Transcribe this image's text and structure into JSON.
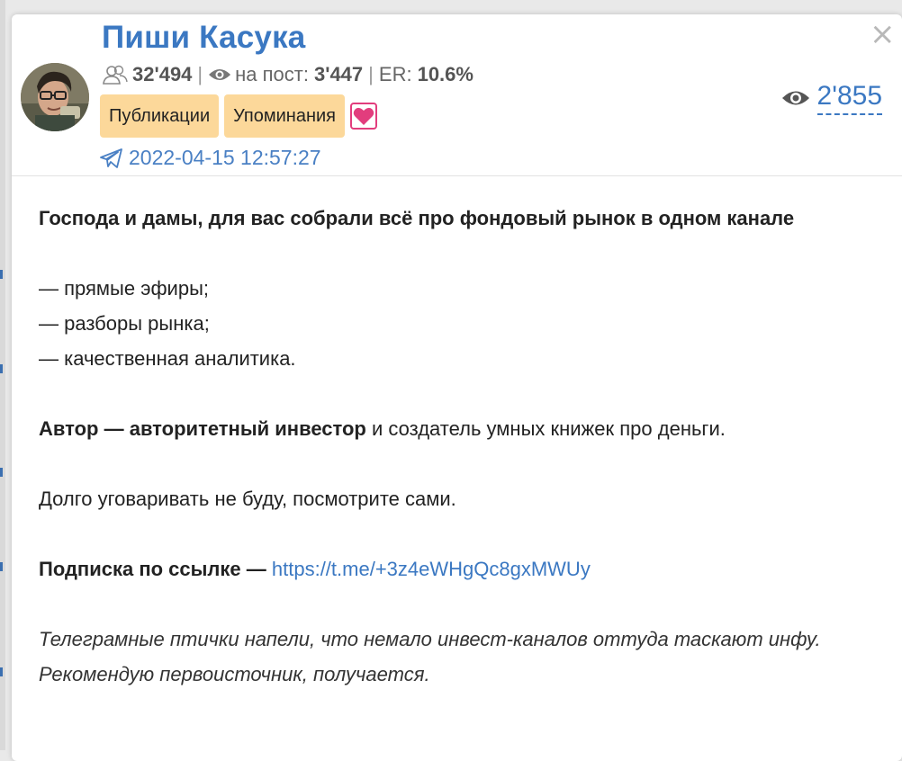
{
  "channel": {
    "title": "Пиши Касука",
    "subscribers": "32'494",
    "reach_label": "на пост:",
    "reach": "3'447",
    "er_label": "ER:",
    "er": "10.6%",
    "date": "2022-04-15 12:57:27",
    "views": "2'855"
  },
  "buttons": {
    "publications": "Публикации",
    "mentions": "Упоминания",
    "close": "×"
  },
  "post": {
    "headline": "Господа и дамы, для вас собрали всё про фондовый рынок в одном канале",
    "list": [
      "— прямые эфиры;",
      "— разборы рынка;",
      "— качественная аналитика."
    ],
    "author_bold": "Автор — авторитетный инвестор",
    "author_rest": " и создатель умных книжек про деньги.",
    "persuade": "Долго уговаривать не буду, посмотрите сами.",
    "subscribe_label": "Подписка по ссылке —",
    "subscribe_link": "https://t.me/+3z4eWHgQc8gxMWUy",
    "footnote": "Телеграмные птички напели, что немало инвест-каналов оттуда таскают инфу. Рекомендую первоисточник, получается."
  },
  "colors": {
    "accent": "#3b78c2",
    "tag_bg": "#fcd89a",
    "heart": "#e23d7d"
  },
  "icons": [
    "subscribers-icon",
    "eye-icon",
    "heart-icon",
    "telegram-plane-icon",
    "close-icon"
  ]
}
